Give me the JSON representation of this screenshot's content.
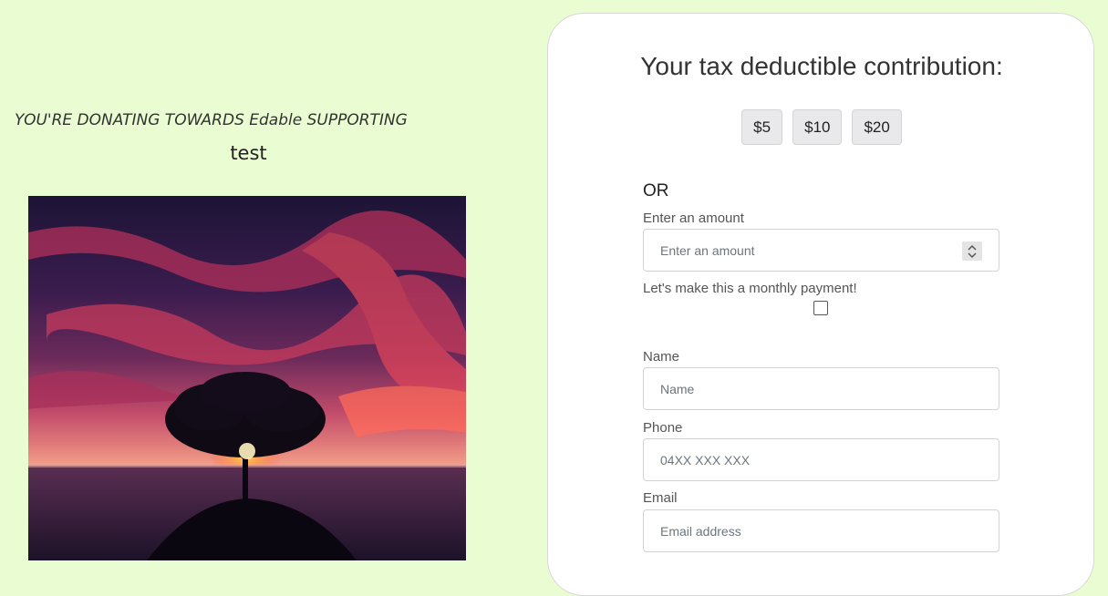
{
  "left": {
    "donating_text": "YOU'RE DONATING TOWARDS Edable SUPPORTING",
    "campaign_name": "test",
    "photo_description_icon": "landscape-photo"
  },
  "form": {
    "title": "Your tax deductible contribution:",
    "presets": [
      "$5",
      "$10",
      "$20"
    ],
    "or_label": "OR",
    "amount": {
      "label": "Enter an amount",
      "placeholder": "Enter an amount",
      "value": ""
    },
    "monthly": {
      "label": "Let's make this a monthly payment!",
      "checked": false
    },
    "name": {
      "label": "Name",
      "placeholder": "Name",
      "value": ""
    },
    "phone": {
      "label": "Phone",
      "placeholder": "04XX XXX XXX",
      "value": ""
    },
    "email": {
      "label": "Email",
      "placeholder": "Email address",
      "value": ""
    }
  },
  "colors": {
    "page_background": "#eafcd2",
    "card_background": "#ffffff",
    "preset_background": "#e9e9ec"
  }
}
